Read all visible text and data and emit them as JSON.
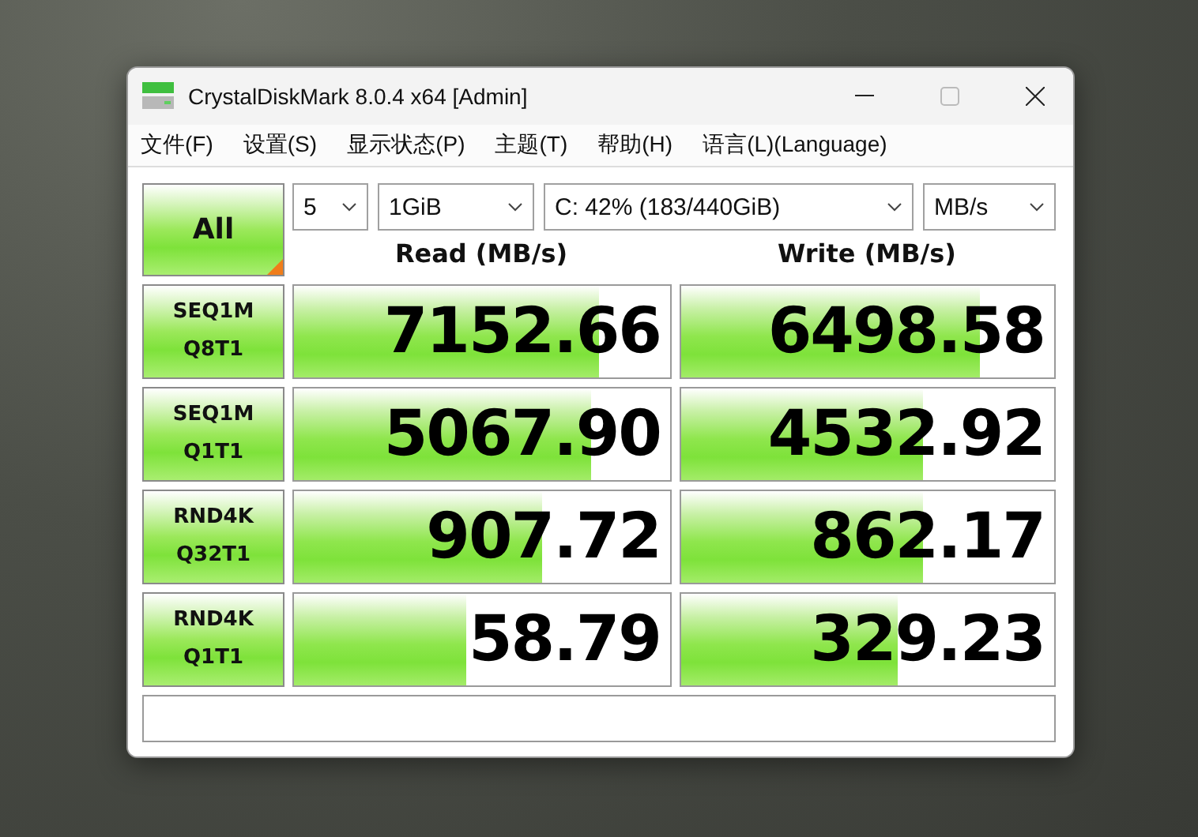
{
  "window": {
    "title": "CrystalDiskMark 8.0.4 x64 [Admin]"
  },
  "menu": [
    "文件(F)",
    "设置(S)",
    "显示状态(P)",
    "主题(T)",
    "帮助(H)",
    "语言(L)(Language)"
  ],
  "all_button": {
    "label": "All"
  },
  "selects": [
    {
      "kind": "count",
      "value": "5"
    },
    {
      "kind": "size",
      "value": "1GiB"
    },
    {
      "kind": "drive",
      "value": "C: 42% (183/440GiB)"
    },
    {
      "kind": "unit",
      "value": "MB/s"
    }
  ],
  "headers": [
    "Read (MB/s)",
    "Write (MB/s)"
  ],
  "rows": [
    {
      "test": [
        "SEQ1M",
        "Q8T1"
      ],
      "read": {
        "value": "7152.66",
        "level": 0.81
      },
      "write": {
        "value": "6498.58",
        "level": 0.8
      }
    },
    {
      "test": [
        "SEQ1M",
        "Q1T1"
      ],
      "read": {
        "value": "5067.90",
        "level": 0.79
      },
      "write": {
        "value": "4532.92",
        "level": 0.65
      }
    },
    {
      "test": [
        "RND4K",
        "Q32T1"
      ],
      "read": {
        "value": "907.72",
        "level": 0.66
      },
      "write": {
        "value": "862.17",
        "level": 0.65
      }
    },
    {
      "test": [
        "RND4K",
        "Q1T1"
      ],
      "read": {
        "value": "58.79",
        "level": 0.46
      },
      "write": {
        "value": "329.23",
        "level": 0.58
      }
    }
  ]
}
